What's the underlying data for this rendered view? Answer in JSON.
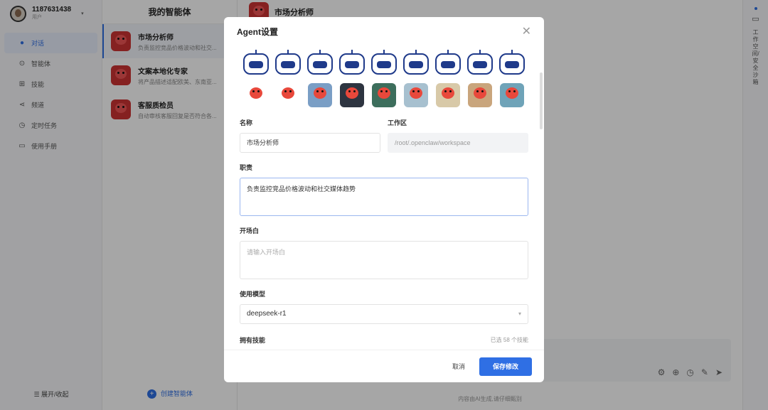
{
  "user": {
    "name": "1187631438",
    "role": "用户"
  },
  "nav": [
    {
      "label": "对话",
      "icon": "chat-icon"
    },
    {
      "label": "智能体",
      "icon": "agent-icon"
    },
    {
      "label": "技能",
      "icon": "skills-icon"
    },
    {
      "label": "频道",
      "icon": "channel-icon"
    },
    {
      "label": "定时任务",
      "icon": "clock-icon"
    },
    {
      "label": "使用手册",
      "icon": "book-icon"
    }
  ],
  "nav_toggle": "展开/收起",
  "agents_panel": {
    "title": "我的智能体",
    "agents": [
      {
        "name": "市场分析师",
        "desc": "负责监控竞品价格波动和社交..."
      },
      {
        "name": "文案本地化专家",
        "desc": "将产品描述适配欧美、东南亚..."
      },
      {
        "name": "客服质检员",
        "desc": "自动审核客服回复是否符合各..."
      }
    ],
    "create_label": "创建智能体"
  },
  "chat": {
    "agent_name": "市场分析师",
    "disclaimer": "内容由AI生成,请仔细甄别"
  },
  "right_panel": {
    "label": "工作空间/安全沙箱"
  },
  "modal": {
    "title": "Agent设置",
    "name_label": "名称",
    "name_value": "市场分析师",
    "workspace_label": "工作区",
    "workspace_value": "/root/.openclaw/workspace",
    "duty_label": "职责",
    "duty_value": "负责监控竞品价格波动和社交媒体趋势",
    "opening_label": "开场白",
    "opening_placeholder": "请输入开场白",
    "model_label": "使用模型",
    "model_value": "deepseek-r1",
    "skills_label": "拥有技能",
    "skills_count": "已选 58 个技能",
    "cancel_label": "取消",
    "save_label": "保存修改"
  },
  "colors": {
    "accent": "#2f6fe4",
    "robot": "#1f3a8a",
    "lobster": "#c8352a"
  }
}
